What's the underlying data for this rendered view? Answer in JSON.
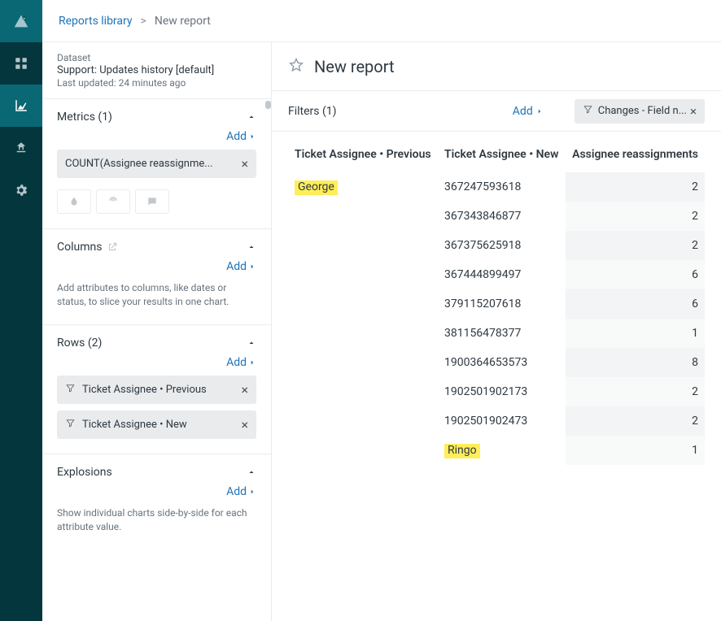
{
  "breadcrumb": {
    "library": "Reports library",
    "sep": ">",
    "current": "New report"
  },
  "dataset": {
    "label": "Dataset",
    "name": "Support: Updates history [default]",
    "updated": "Last updated: 24 minutes ago"
  },
  "sections": {
    "metrics": {
      "title": "Metrics (1)",
      "add": "Add"
    },
    "columns": {
      "title": "Columns",
      "add": "Add",
      "helper": "Add attributes to columns, like dates or status, to slice your results in one chart."
    },
    "rows": {
      "title": "Rows (2)",
      "add": "Add"
    },
    "explosions": {
      "title": "Explosions",
      "add": "Add",
      "helper": "Show individual charts side-by-side for each attribute value."
    }
  },
  "metricsPills": [
    "COUNT(Assignee reassignme..."
  ],
  "rowsPills": [
    "Ticket Assignee • Previous",
    "Ticket Assignee • New"
  ],
  "report": {
    "title": "New report"
  },
  "filters": {
    "label": "Filters (1)",
    "add": "Add",
    "pill": "Changes - Field n..."
  },
  "table": {
    "headers": {
      "prev": "Ticket Assignee • Previous",
      "new": "Ticket Assignee • New",
      "count": "Assignee reassignments"
    },
    "rows": [
      {
        "prev": "George",
        "prevHighlight": true,
        "new": "367247593618",
        "count": 2
      },
      {
        "prev": "",
        "new": "367343846877",
        "count": 2
      },
      {
        "prev": "",
        "new": "367375625918",
        "count": 2
      },
      {
        "prev": "",
        "new": "367444899497",
        "count": 6
      },
      {
        "prev": "",
        "new": "379115207618",
        "count": 6
      },
      {
        "prev": "",
        "new": "381156478377",
        "count": 1
      },
      {
        "prev": "",
        "new": "1900364653573",
        "count": 8
      },
      {
        "prev": "",
        "new": "1902501902173",
        "count": 2
      },
      {
        "prev": "",
        "new": "1902501902473",
        "count": 2
      },
      {
        "prev": "",
        "new": "Ringo",
        "newHighlight": true,
        "count": 1
      }
    ]
  }
}
